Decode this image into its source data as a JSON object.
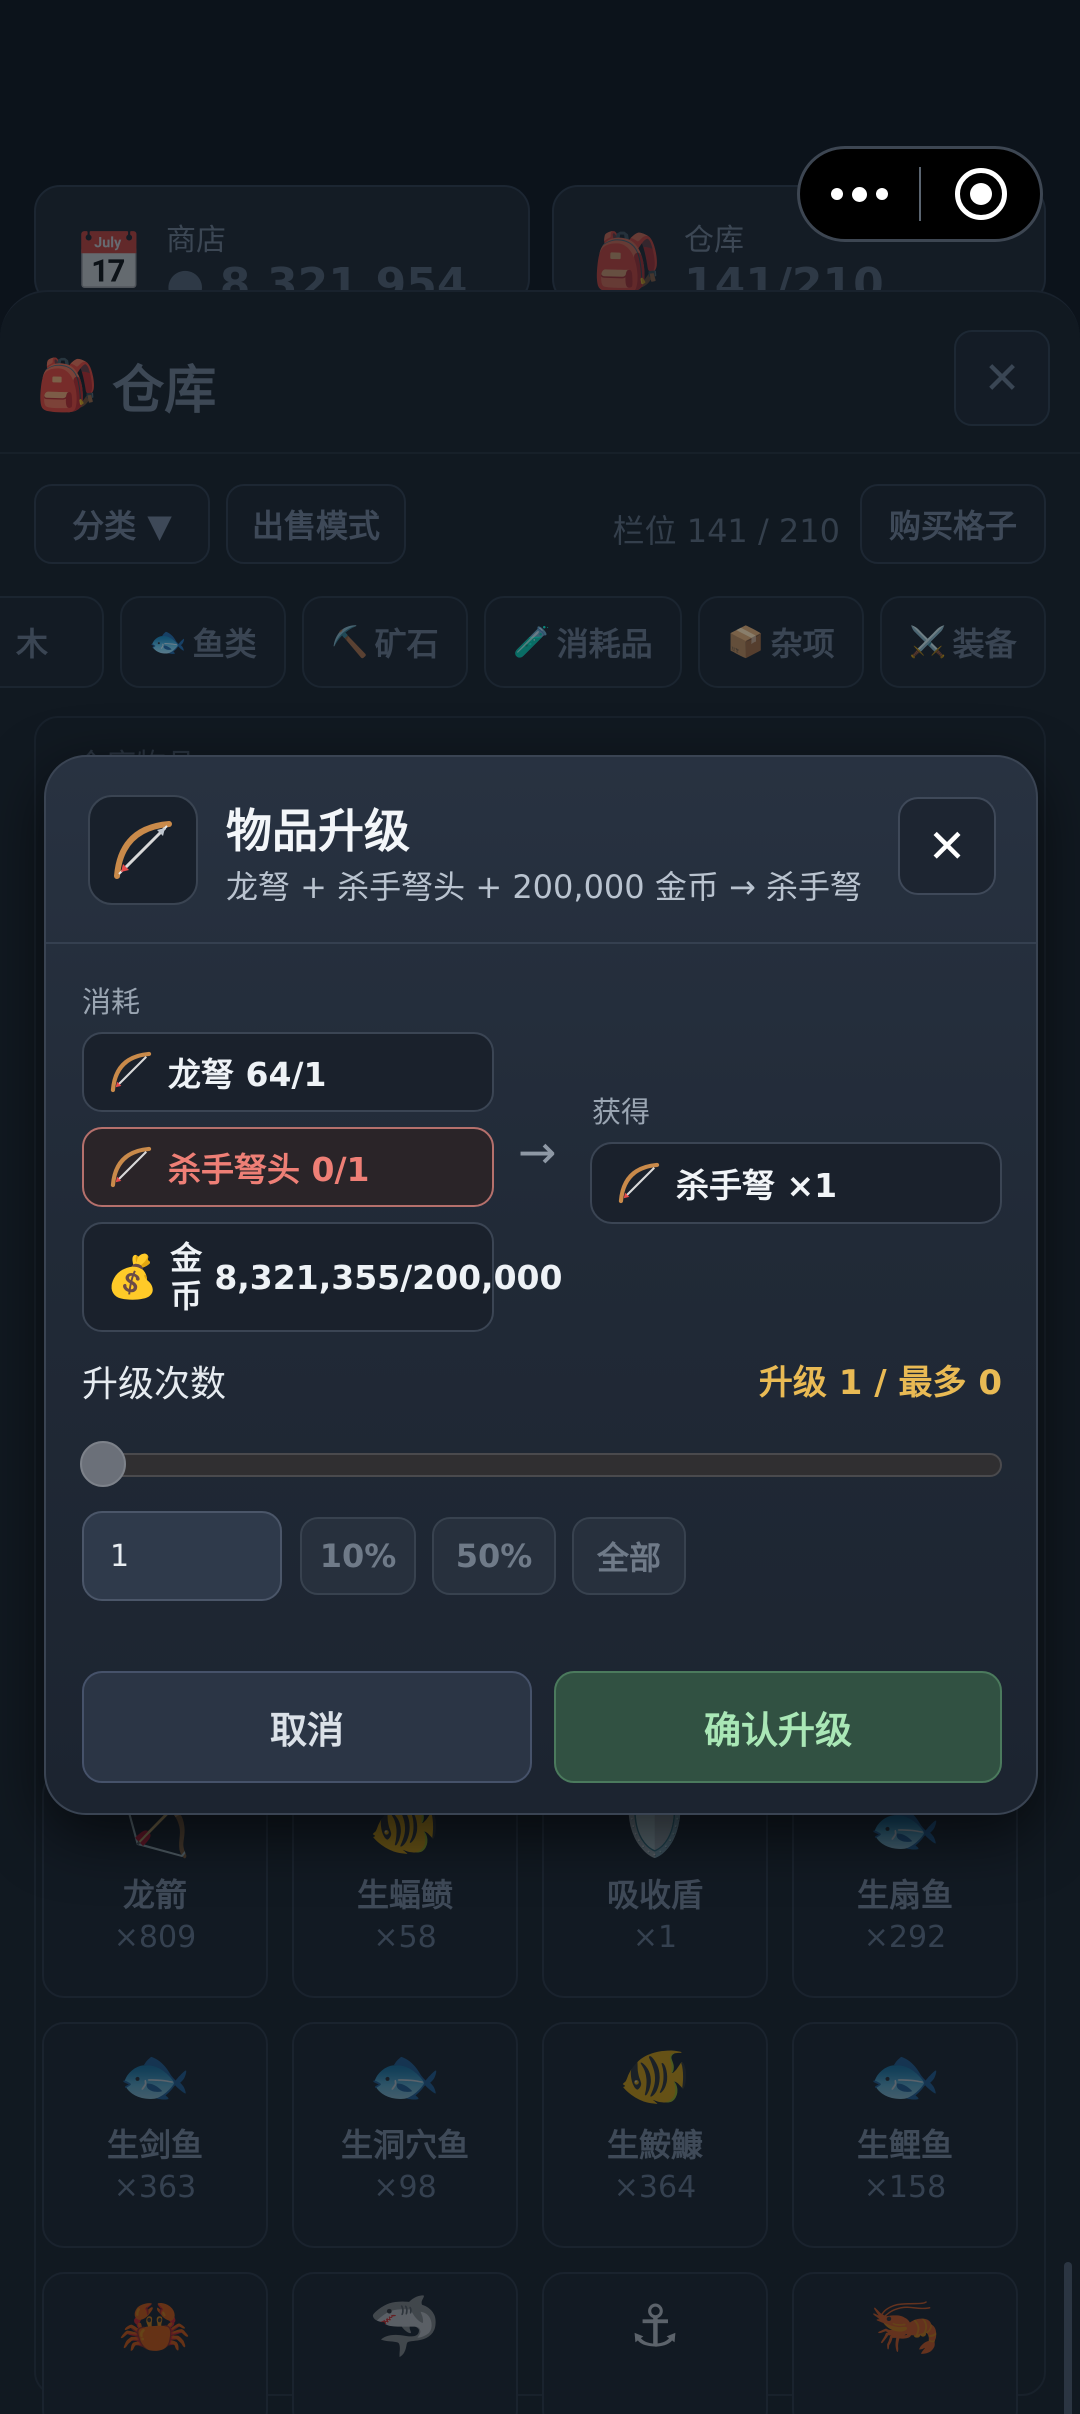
{
  "background": {
    "shop_card": {
      "icon": "calendar-shop-icon",
      "label": "商店",
      "value": "● 8,321,954"
    },
    "warehouse_card": {
      "icon": "backpack-icon",
      "label": "仓库",
      "value": "141/210"
    },
    "panel": {
      "icon": "backpack-icon",
      "title": "仓库",
      "close": "✕",
      "category_button": "分类 ▼",
      "sell_mode_button": "出售模式",
      "slots_text": "栏位 141 / 210",
      "buy_slots_button": "购买格子",
      "tabs": [
        {
          "icon": "",
          "label": "木"
        },
        {
          "icon": "🐟",
          "label": "鱼类"
        },
        {
          "icon": "⛏️",
          "label": "矿石"
        },
        {
          "icon": "🧪",
          "label": "消耗品"
        },
        {
          "icon": "📦",
          "label": "杂项"
        },
        {
          "icon": "⚔️",
          "label": "装备"
        }
      ],
      "box_label": "仓库物品",
      "items_row1": [
        {
          "icon": "🏹",
          "name": "龙箭",
          "count": "×809"
        },
        {
          "icon": "🐠",
          "name": "生蝠鲼",
          "count": "×58"
        },
        {
          "icon": "🛡️",
          "name": "吸收盾",
          "count": "×1"
        },
        {
          "icon": "🐟",
          "name": "生扇鱼",
          "count": "×292"
        }
      ],
      "items_row2": [
        {
          "icon": "🐟",
          "name": "生剑鱼",
          "count": "×363"
        },
        {
          "icon": "🐟",
          "name": "生洞穴鱼",
          "count": "×98"
        },
        {
          "icon": "🐠",
          "name": "生鮟鱇",
          "count": "×364"
        },
        {
          "icon": "🐟",
          "name": "生鲤鱼",
          "count": "×158"
        }
      ],
      "items_row3": [
        {
          "icon": "🦀"
        },
        {
          "icon": "🦈"
        },
        {
          "icon": "⚓"
        },
        {
          "icon": "🦐"
        }
      ]
    }
  },
  "modal": {
    "icon": "bow-arrow-icon",
    "title": "物品升级",
    "subtitle": "龙弩 + 杀手弩头 + 200,000 金币 → 杀手弩",
    "close": "✕",
    "consume_label": "消耗",
    "consume_items": [
      {
        "text": "龙弩 64/1",
        "sufficient": true
      },
      {
        "text": "杀手弩头 0/1",
        "sufficient": false
      }
    ],
    "gold": {
      "icon": "💰",
      "label_top": "金",
      "label_bottom": "币",
      "value": "8,321,355/200,000"
    },
    "arrow": "→",
    "gain_label": "获得",
    "gain_item": "杀手弩 ×1",
    "count_label": "升级次数",
    "count_status": "升级 1 / 最多 0",
    "slider_value": 0,
    "quantity_value": "1",
    "quick_buttons": [
      "10%",
      "50%",
      "全部"
    ],
    "cancel_label": "取消",
    "confirm_label": "确认升级"
  },
  "colors": {
    "accent_gold": "#e9ba54",
    "error_red": "#ee7f76",
    "confirm_green": "#a9e7b6"
  }
}
